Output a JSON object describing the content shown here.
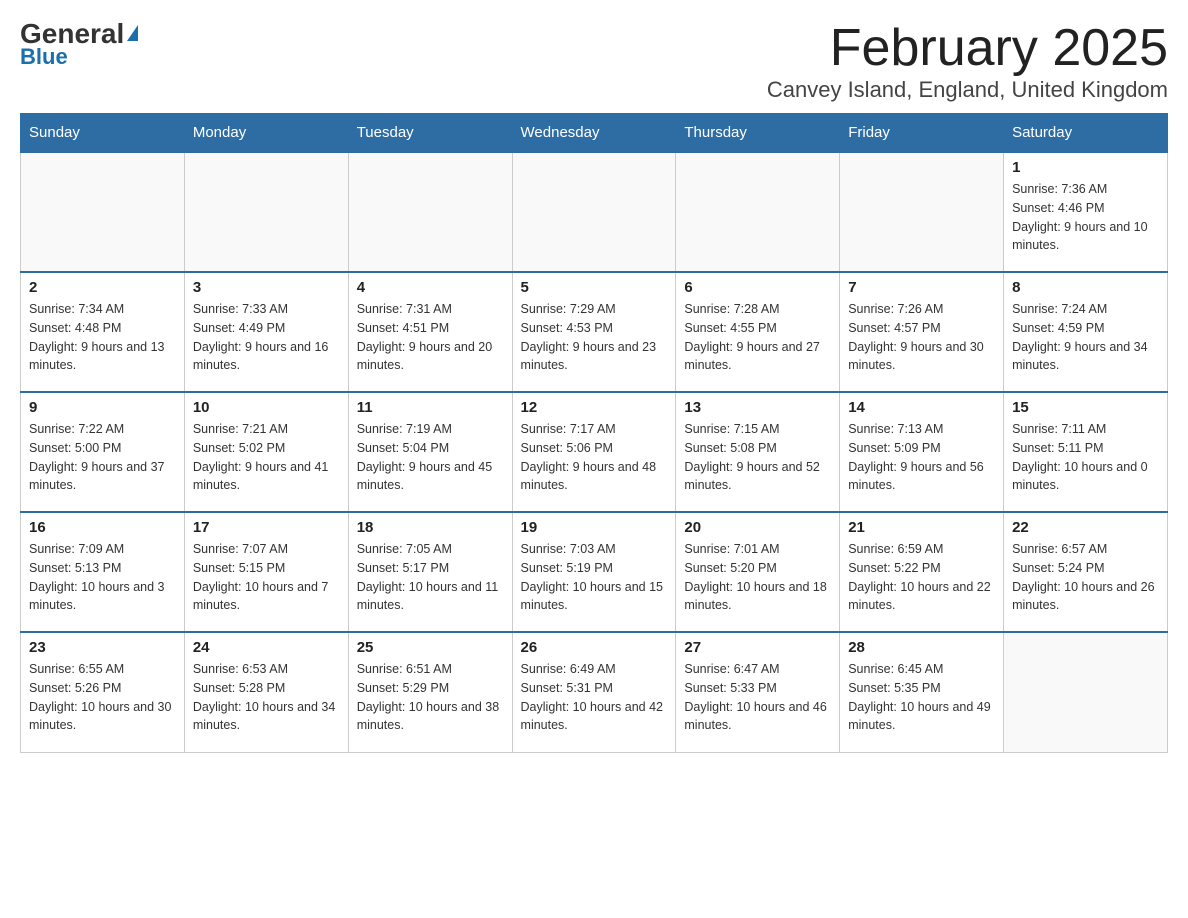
{
  "logo": {
    "general": "General",
    "blue": "Blue"
  },
  "header": {
    "month": "February 2025",
    "location": "Canvey Island, England, United Kingdom"
  },
  "weekdays": [
    "Sunday",
    "Monday",
    "Tuesday",
    "Wednesday",
    "Thursday",
    "Friday",
    "Saturday"
  ],
  "weeks": [
    [
      {
        "day": "",
        "sunrise": "",
        "sunset": "",
        "daylight": ""
      },
      {
        "day": "",
        "sunrise": "",
        "sunset": "",
        "daylight": ""
      },
      {
        "day": "",
        "sunrise": "",
        "sunset": "",
        "daylight": ""
      },
      {
        "day": "",
        "sunrise": "",
        "sunset": "",
        "daylight": ""
      },
      {
        "day": "",
        "sunrise": "",
        "sunset": "",
        "daylight": ""
      },
      {
        "day": "",
        "sunrise": "",
        "sunset": "",
        "daylight": ""
      },
      {
        "day": "1",
        "sunrise": "Sunrise: 7:36 AM",
        "sunset": "Sunset: 4:46 PM",
        "daylight": "Daylight: 9 hours and 10 minutes."
      }
    ],
    [
      {
        "day": "2",
        "sunrise": "Sunrise: 7:34 AM",
        "sunset": "Sunset: 4:48 PM",
        "daylight": "Daylight: 9 hours and 13 minutes."
      },
      {
        "day": "3",
        "sunrise": "Sunrise: 7:33 AM",
        "sunset": "Sunset: 4:49 PM",
        "daylight": "Daylight: 9 hours and 16 minutes."
      },
      {
        "day": "4",
        "sunrise": "Sunrise: 7:31 AM",
        "sunset": "Sunset: 4:51 PM",
        "daylight": "Daylight: 9 hours and 20 minutes."
      },
      {
        "day": "5",
        "sunrise": "Sunrise: 7:29 AM",
        "sunset": "Sunset: 4:53 PM",
        "daylight": "Daylight: 9 hours and 23 minutes."
      },
      {
        "day": "6",
        "sunrise": "Sunrise: 7:28 AM",
        "sunset": "Sunset: 4:55 PM",
        "daylight": "Daylight: 9 hours and 27 minutes."
      },
      {
        "day": "7",
        "sunrise": "Sunrise: 7:26 AM",
        "sunset": "Sunset: 4:57 PM",
        "daylight": "Daylight: 9 hours and 30 minutes."
      },
      {
        "day": "8",
        "sunrise": "Sunrise: 7:24 AM",
        "sunset": "Sunset: 4:59 PM",
        "daylight": "Daylight: 9 hours and 34 minutes."
      }
    ],
    [
      {
        "day": "9",
        "sunrise": "Sunrise: 7:22 AM",
        "sunset": "Sunset: 5:00 PM",
        "daylight": "Daylight: 9 hours and 37 minutes."
      },
      {
        "day": "10",
        "sunrise": "Sunrise: 7:21 AM",
        "sunset": "Sunset: 5:02 PM",
        "daylight": "Daylight: 9 hours and 41 minutes."
      },
      {
        "day": "11",
        "sunrise": "Sunrise: 7:19 AM",
        "sunset": "Sunset: 5:04 PM",
        "daylight": "Daylight: 9 hours and 45 minutes."
      },
      {
        "day": "12",
        "sunrise": "Sunrise: 7:17 AM",
        "sunset": "Sunset: 5:06 PM",
        "daylight": "Daylight: 9 hours and 48 minutes."
      },
      {
        "day": "13",
        "sunrise": "Sunrise: 7:15 AM",
        "sunset": "Sunset: 5:08 PM",
        "daylight": "Daylight: 9 hours and 52 minutes."
      },
      {
        "day": "14",
        "sunrise": "Sunrise: 7:13 AM",
        "sunset": "Sunset: 5:09 PM",
        "daylight": "Daylight: 9 hours and 56 minutes."
      },
      {
        "day": "15",
        "sunrise": "Sunrise: 7:11 AM",
        "sunset": "Sunset: 5:11 PM",
        "daylight": "Daylight: 10 hours and 0 minutes."
      }
    ],
    [
      {
        "day": "16",
        "sunrise": "Sunrise: 7:09 AM",
        "sunset": "Sunset: 5:13 PM",
        "daylight": "Daylight: 10 hours and 3 minutes."
      },
      {
        "day": "17",
        "sunrise": "Sunrise: 7:07 AM",
        "sunset": "Sunset: 5:15 PM",
        "daylight": "Daylight: 10 hours and 7 minutes."
      },
      {
        "day": "18",
        "sunrise": "Sunrise: 7:05 AM",
        "sunset": "Sunset: 5:17 PM",
        "daylight": "Daylight: 10 hours and 11 minutes."
      },
      {
        "day": "19",
        "sunrise": "Sunrise: 7:03 AM",
        "sunset": "Sunset: 5:19 PM",
        "daylight": "Daylight: 10 hours and 15 minutes."
      },
      {
        "day": "20",
        "sunrise": "Sunrise: 7:01 AM",
        "sunset": "Sunset: 5:20 PM",
        "daylight": "Daylight: 10 hours and 18 minutes."
      },
      {
        "day": "21",
        "sunrise": "Sunrise: 6:59 AM",
        "sunset": "Sunset: 5:22 PM",
        "daylight": "Daylight: 10 hours and 22 minutes."
      },
      {
        "day": "22",
        "sunrise": "Sunrise: 6:57 AM",
        "sunset": "Sunset: 5:24 PM",
        "daylight": "Daylight: 10 hours and 26 minutes."
      }
    ],
    [
      {
        "day": "23",
        "sunrise": "Sunrise: 6:55 AM",
        "sunset": "Sunset: 5:26 PM",
        "daylight": "Daylight: 10 hours and 30 minutes."
      },
      {
        "day": "24",
        "sunrise": "Sunrise: 6:53 AM",
        "sunset": "Sunset: 5:28 PM",
        "daylight": "Daylight: 10 hours and 34 minutes."
      },
      {
        "day": "25",
        "sunrise": "Sunrise: 6:51 AM",
        "sunset": "Sunset: 5:29 PM",
        "daylight": "Daylight: 10 hours and 38 minutes."
      },
      {
        "day": "26",
        "sunrise": "Sunrise: 6:49 AM",
        "sunset": "Sunset: 5:31 PM",
        "daylight": "Daylight: 10 hours and 42 minutes."
      },
      {
        "day": "27",
        "sunrise": "Sunrise: 6:47 AM",
        "sunset": "Sunset: 5:33 PM",
        "daylight": "Daylight: 10 hours and 46 minutes."
      },
      {
        "day": "28",
        "sunrise": "Sunrise: 6:45 AM",
        "sunset": "Sunset: 5:35 PM",
        "daylight": "Daylight: 10 hours and 49 minutes."
      },
      {
        "day": "",
        "sunrise": "",
        "sunset": "",
        "daylight": ""
      }
    ]
  ]
}
